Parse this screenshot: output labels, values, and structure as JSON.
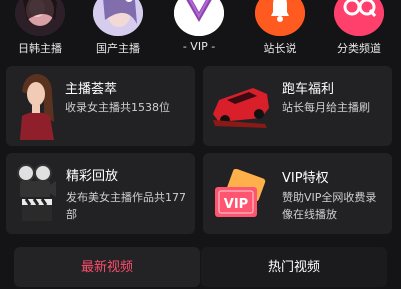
{
  "nav": {
    "items": [
      {
        "label": "日韩主播",
        "icon": "portrait-avatar"
      },
      {
        "label": "国产主播",
        "icon": "portrait-avatar"
      },
      {
        "label": "- VIP -",
        "icon": "vip-v-icon"
      },
      {
        "label": "站长说",
        "icon": "bell-icon"
      },
      {
        "label": "分类频道",
        "icon": "oq-logo-icon"
      }
    ]
  },
  "cards": [
    {
      "title": "主播荟萃",
      "subtitle": "收录女主播共1538位",
      "icon": "woman-portrait"
    },
    {
      "title": "跑车福利",
      "subtitle": "站长每月给主播刷",
      "icon": "red-sports-car-icon"
    },
    {
      "title": "精彩回放",
      "subtitle": "发布美女主播作品共177部",
      "icon": "film-camera-clapboard-icon"
    },
    {
      "title": "VIP特权",
      "subtitle": "赞助VIP全网收费录像在线播放",
      "icon": "vip-tickets-icon"
    }
  ],
  "tabs": [
    {
      "label": "最新视频",
      "active": true
    },
    {
      "label": "热门视频",
      "active": false
    }
  ],
  "colors": {
    "background": "#141416",
    "card": "#222225",
    "active_tab": "#ff4d6d",
    "vip_purple": "#8e44ad",
    "bell_orange": "#ff5a1f",
    "oq_pink": "#ff3f6c"
  }
}
